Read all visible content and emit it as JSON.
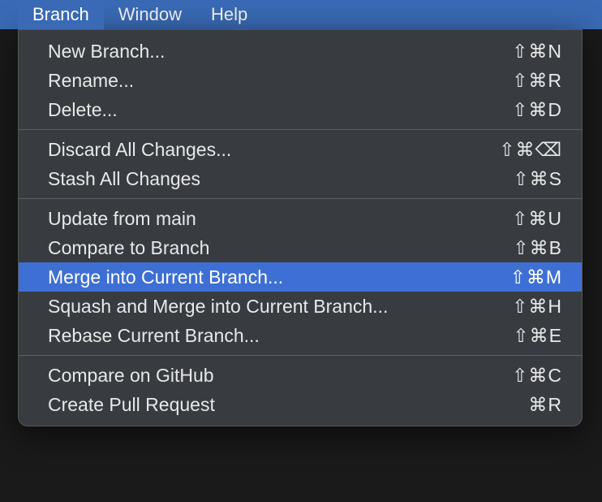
{
  "menubar": {
    "items": [
      {
        "label": "Branch",
        "active": true
      },
      {
        "label": "Window",
        "active": false
      },
      {
        "label": "Help",
        "active": false
      }
    ]
  },
  "dropdown": {
    "groups": [
      [
        {
          "label": "New Branch...",
          "shortcut": "⇧⌘N",
          "highlighted": false
        },
        {
          "label": "Rename...",
          "shortcut": "⇧⌘R",
          "highlighted": false
        },
        {
          "label": "Delete...",
          "shortcut": "⇧⌘D",
          "highlighted": false
        }
      ],
      [
        {
          "label": "Discard All Changes...",
          "shortcut": "⇧⌘⌫",
          "highlighted": false
        },
        {
          "label": "Stash All Changes",
          "shortcut": "⇧⌘S",
          "highlighted": false
        }
      ],
      [
        {
          "label": "Update from main",
          "shortcut": "⇧⌘U",
          "highlighted": false
        },
        {
          "label": "Compare to Branch",
          "shortcut": "⇧⌘B",
          "highlighted": false
        },
        {
          "label": "Merge into Current Branch...",
          "shortcut": "⇧⌘M",
          "highlighted": true
        },
        {
          "label": "Squash and Merge into Current Branch...",
          "shortcut": "⇧⌘H",
          "highlighted": false
        },
        {
          "label": "Rebase Current Branch...",
          "shortcut": "⇧⌘E",
          "highlighted": false
        }
      ],
      [
        {
          "label": "Compare on GitHub",
          "shortcut": "⇧⌘C",
          "highlighted": false
        },
        {
          "label": "Create Pull Request",
          "shortcut": "⌘R",
          "highlighted": false
        }
      ]
    ]
  }
}
